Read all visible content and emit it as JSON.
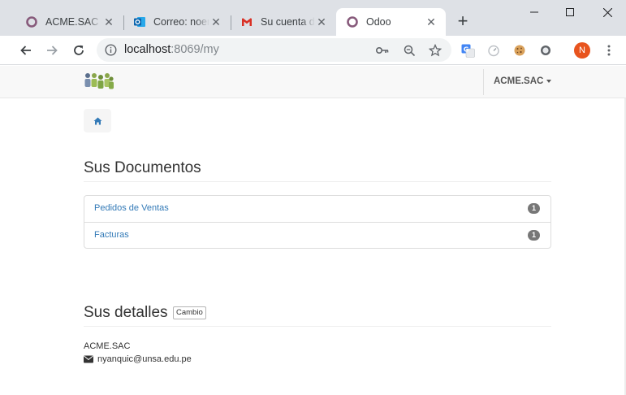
{
  "browser": {
    "tabs": [
      {
        "title": "ACME.SAC -",
        "icon": "odoo-icon",
        "active": false
      },
      {
        "title": "Correo: noem",
        "icon": "outlook-icon",
        "active": false
      },
      {
        "title": "Su cuenta de",
        "icon": "gmail-icon",
        "active": false
      },
      {
        "title": "Odoo",
        "icon": "odoo-icon",
        "active": true
      }
    ],
    "new_tab_label": "+",
    "window_controls": {
      "minimize": "–",
      "maximize": "☐",
      "close": "✕"
    },
    "address": {
      "host": "localhost",
      "path": ":8069/my"
    },
    "profile_initial": "N",
    "colors": {
      "tabstrip": "#dee1e6",
      "profile": "#e8541e"
    }
  },
  "odoo": {
    "company_menu": "ACME.SAC",
    "section_documents": {
      "title": "Sus Documentos",
      "items": [
        {
          "label": "Pedidos de Ventas",
          "count": "1"
        },
        {
          "label": "Facturas",
          "count": "1"
        }
      ]
    },
    "section_details": {
      "title": "Sus detalles",
      "edit_button": "Cambio",
      "name": "ACME.SAC",
      "email": "nyanquic@unsa.edu.pe"
    },
    "colors": {
      "link": "#337ab7",
      "badge": "#777777"
    }
  }
}
